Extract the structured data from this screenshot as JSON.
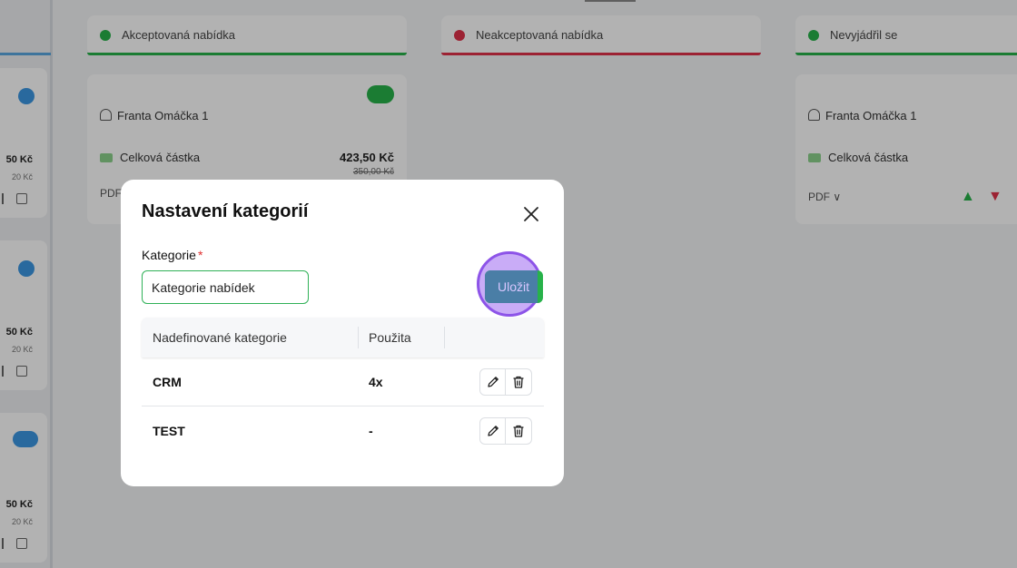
{
  "background": {
    "columns": [
      {
        "title": "Akceptovaná nabídka",
        "color": "#27b24a"
      },
      {
        "title": "Neakceptovaná nabídka",
        "color": "#e0314a"
      },
      {
        "title": "Nevyjádřil se",
        "color": "#27b24a"
      }
    ],
    "cards": [
      {
        "name": "Franta Omáčka 1",
        "total_label": "Celková částka",
        "price": "423,50 Kč",
        "price_old": "350,00 Kč",
        "pdf_label": "PDF"
      },
      {
        "name": "Franta Omáčka 1",
        "total_label": "Celková částka",
        "pdf_label": "PDF ∨"
      }
    ],
    "left_cards": [
      {
        "amount": "50 Kč",
        "amount_old": "20 Kč"
      },
      {
        "amount": "50 Kč",
        "amount_old": "20 Kč"
      },
      {
        "amount": "50 Kč",
        "amount_old": "20 Kč"
      }
    ]
  },
  "modal": {
    "title": "Nastavení kategorií",
    "field_label": "Kategorie",
    "required_mark": "*",
    "input_value": "Kategorie nabídek",
    "save_label": "Uložit",
    "table": {
      "headers": [
        "Nadefinované kategorie",
        "Použita",
        ""
      ],
      "rows": [
        {
          "name": "CRM",
          "used": "4x"
        },
        {
          "name": "TEST",
          "used": "-"
        }
      ]
    }
  },
  "colors": {
    "accent_green": "#27b24a",
    "highlight_purple": "#8d54e8",
    "required_red": "#e03030"
  },
  "icons": {
    "close": "close-icon",
    "edit": "pencil-icon",
    "delete": "trash-icon"
  }
}
